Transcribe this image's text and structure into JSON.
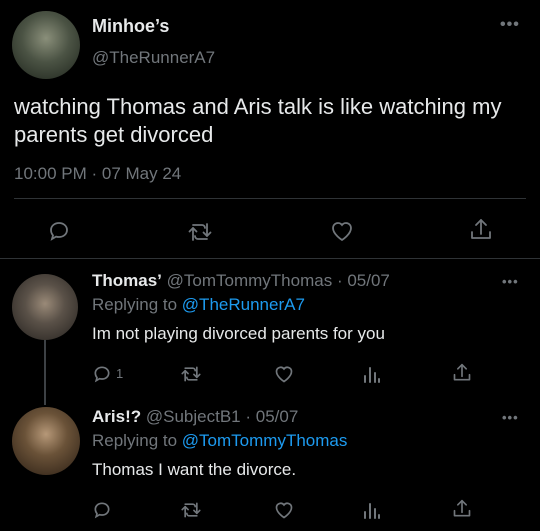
{
  "main_tweet": {
    "display_name": "Minhoe’s",
    "handle": "@TheRunnerA7",
    "text": "watching Thomas and Aris talk is like watching my parents get divorced",
    "timestamp": "10:00 PM · 07 May 24",
    "more_glyph": "•••",
    "actions": [
      "reply-icon",
      "retweet-icon",
      "like-icon",
      "share-icon"
    ]
  },
  "replies": [
    {
      "display_name": "Thomas’",
      "handle": "@TomTommyThomas",
      "date": "· 05/07",
      "replying_prefix": "Replying to",
      "replying_to": "@TheRunnerA7",
      "text": "Im not playing divorced parents for you",
      "reply_count": "1",
      "more_glyph": "•••"
    },
    {
      "display_name": "Aris!?",
      "handle": "@SubjectB1",
      "date": "· 05/07",
      "replying_prefix": "Replying to",
      "replying_to": "@TomTommyThomas",
      "text": "Thomas I want the divorce.",
      "more_glyph": "•••"
    }
  ],
  "colors": {
    "background": "#000000",
    "text_primary": "#e7e9ea",
    "text_secondary": "#71767b",
    "link": "#1d9bf0",
    "divider": "#2f3336"
  }
}
